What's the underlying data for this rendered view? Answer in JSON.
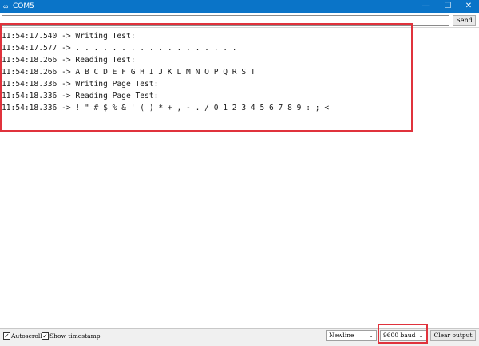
{
  "window": {
    "title": "COM5",
    "app_icon": "arduino-infinity-icon",
    "controls": {
      "minimize": "minimize-icon",
      "maximize": "maximize-icon",
      "close": "close-icon"
    }
  },
  "send_bar": {
    "input_value": "",
    "send_label": "Send"
  },
  "output": {
    "lines": [
      "11:54:17.540 -> Writing Test:",
      "11:54:17.577 -> . . . . . . . . . . . . . . . . . .",
      "11:54:18.266 -> Reading Test:",
      "11:54:18.266 -> A B C D E F G H I J K L M N O P Q R S T",
      "11:54:18.336 -> Writing Page Test:",
      "11:54:18.336 -> Reading Page Test:",
      "11:54:18.336 -> ! \" # $ % & ' ( ) * + , - . / 0 1 2 3 4 5 6 7 8 9 : ; <"
    ]
  },
  "status_bar": {
    "autoscroll": {
      "label": "Autoscroll",
      "checked": true
    },
    "show_timestamp": {
      "label": "Show timestamp",
      "checked": true
    },
    "line_ending": "Newline",
    "baud_rate": "9600 baud",
    "clear_label": "Clear output"
  },
  "colors": {
    "titlebar": "#0a74c8",
    "highlight": "#e0323c"
  }
}
